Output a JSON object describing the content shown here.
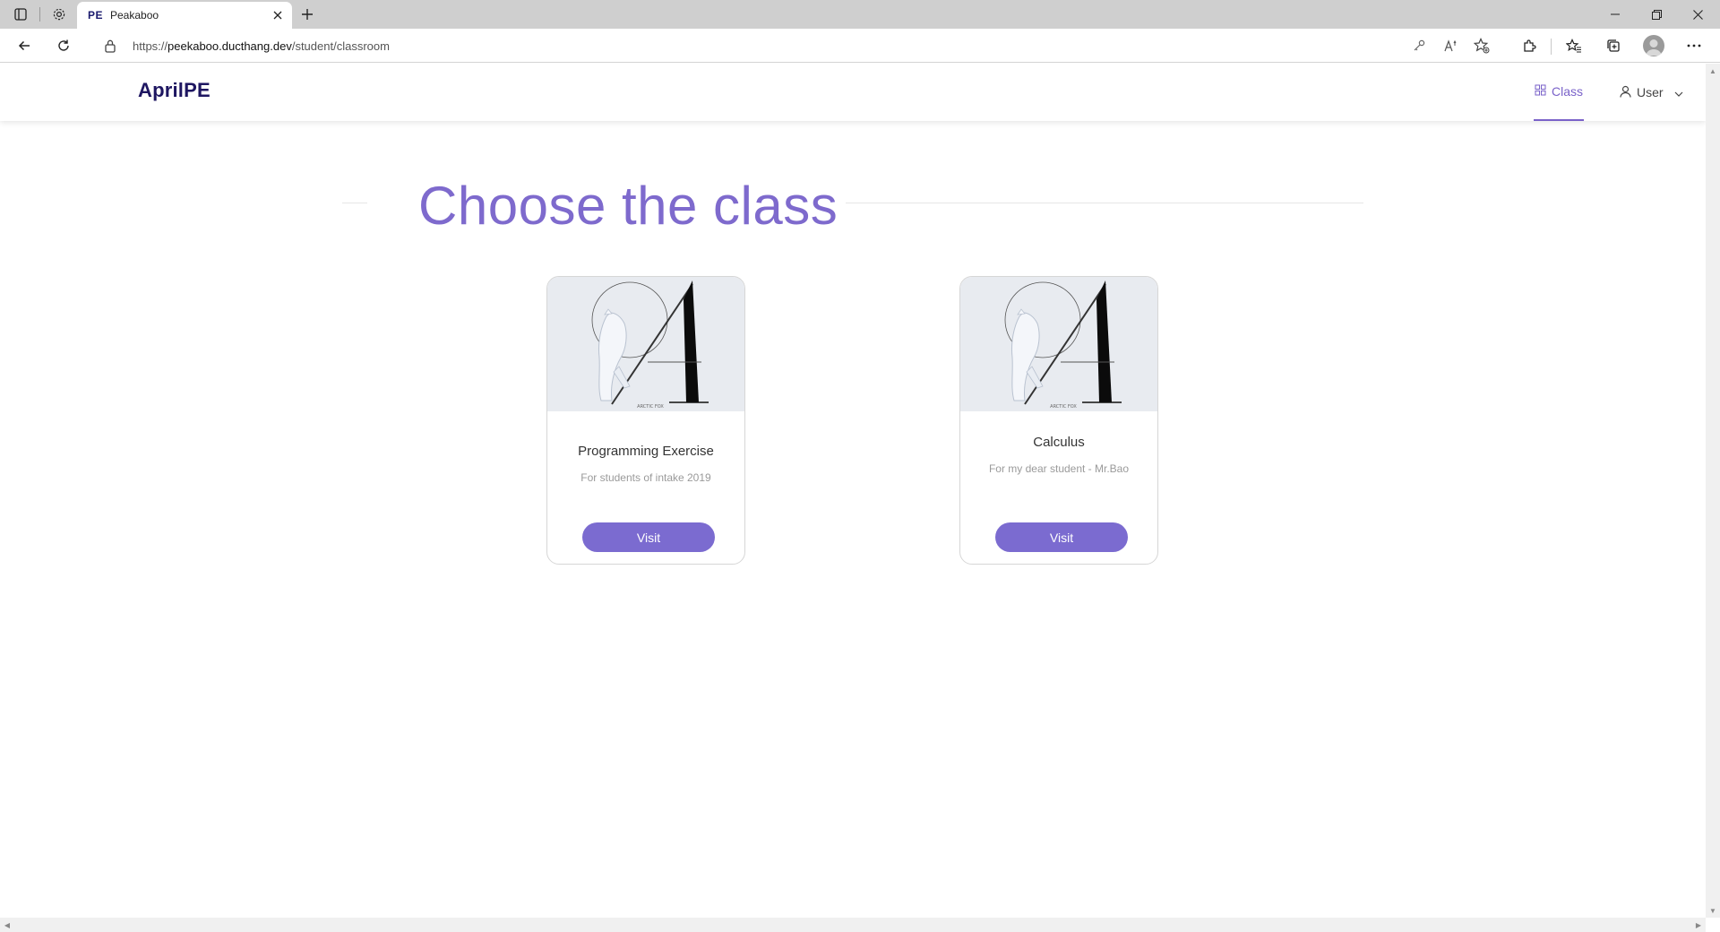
{
  "browser": {
    "tab": {
      "favicon_text": "PE",
      "title": "Peakaboo"
    },
    "url": {
      "scheme": "https://",
      "host": "peekaboo.ducthang.dev",
      "path": "/student/classroom"
    }
  },
  "app": {
    "brand": "AprilPE",
    "nav": {
      "class_label": "Class",
      "user_label": "User"
    }
  },
  "page": {
    "title": "Choose the class",
    "classes": [
      {
        "title": "Programming Exercise",
        "description": "For students of intake 2019",
        "button": "Visit",
        "image_caption": "ARCTIC FOX"
      },
      {
        "title": "Calculus",
        "description": "For my dear student - Mr.Bao",
        "button": "Visit",
        "image_caption": "ARCTIC FOX"
      }
    ]
  },
  "colors": {
    "accent": "#7b6bd0",
    "brand": "#1e1661",
    "title": "#7e6acd"
  }
}
